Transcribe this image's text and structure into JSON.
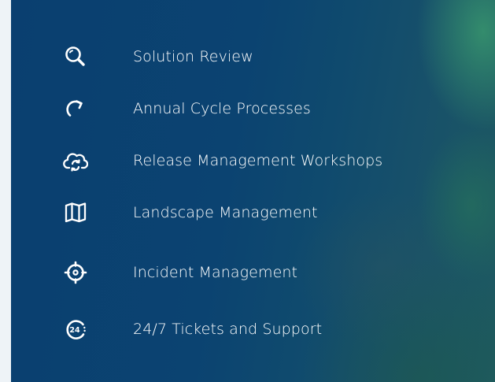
{
  "accent_color": "#ffffff",
  "panel_color": "#0b4371",
  "items": [
    {
      "icon": "search-icon",
      "label": "Solution Review"
    },
    {
      "icon": "refresh-arrow-icon",
      "label": "Annual Cycle Processes"
    },
    {
      "icon": "cloud-sync-icon",
      "label": "Release Management Workshops"
    },
    {
      "icon": "map-icon",
      "label": "Landscape Management"
    },
    {
      "icon": "target-crosshair-icon",
      "label": "Incident Management"
    },
    {
      "icon": "24-hours-support-icon",
      "label": "24/7 Tickets and Support",
      "icon_text": "24"
    }
  ]
}
